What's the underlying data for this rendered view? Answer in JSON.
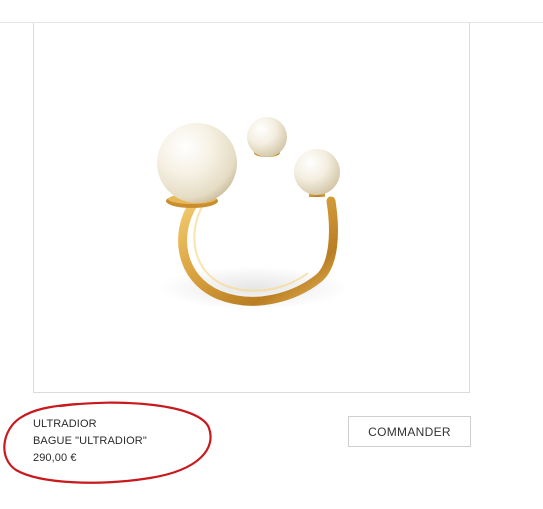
{
  "product": {
    "collection": "ULTRADIOR",
    "name": "BAGUE \"ULTRADIOR\"",
    "price": "290,00 €",
    "image_icon": "pearl-ring-image"
  },
  "actions": {
    "order_label": "COMMANDER"
  },
  "annotation": {
    "color": "#c8191e"
  },
  "colors": {
    "gold": "#d9a23f",
    "pearl": "#f4efe2"
  }
}
